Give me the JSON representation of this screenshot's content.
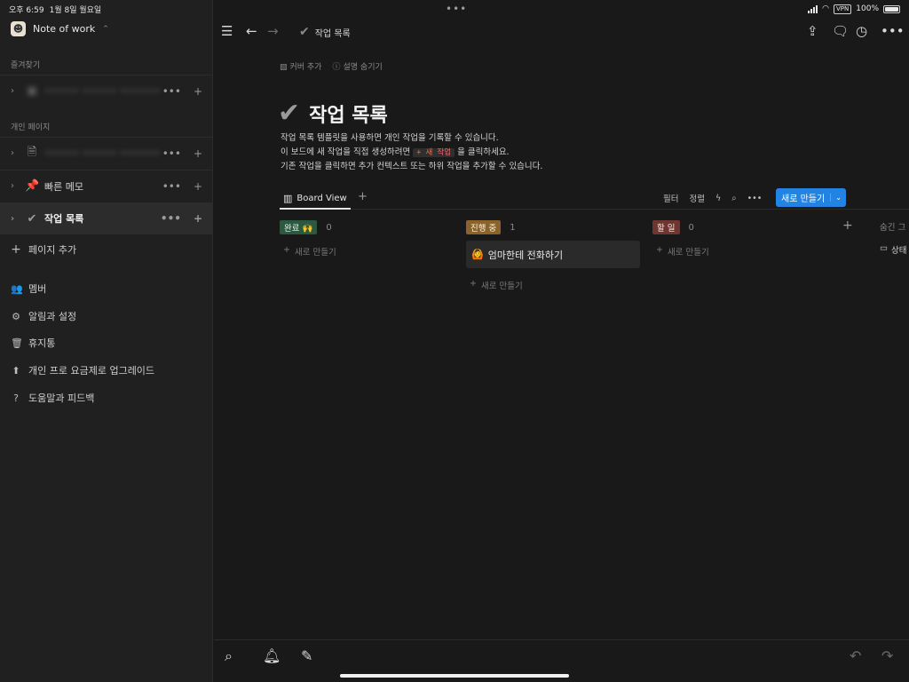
{
  "status": {
    "time": "오후 6:59",
    "date": "1월 8일 월요일",
    "dots": "•••",
    "vpn": "VPN",
    "battery": "100%"
  },
  "sidebar": {
    "workspace": "Note of work",
    "favorites_label": "즐겨찾기",
    "favorites": [
      {
        "label": "•••••• •••••• •••••••"
      }
    ],
    "private_label": "개인 페이지",
    "pages": [
      {
        "label": "•••••• •••••• •••••••",
        "icon": "document-icon",
        "blurred": true
      },
      {
        "label": "빠른 메모",
        "icon": "pushpin-icon"
      },
      {
        "label": "작업 목록",
        "icon": "checkmark-icon",
        "active": true
      }
    ],
    "add_page": "페이지 추가",
    "links": [
      {
        "label": "멤버",
        "icon": "members-icon"
      },
      {
        "label": "알림과 설정",
        "icon": "settings-icon"
      },
      {
        "label": "휴지통",
        "icon": "trash-icon"
      },
      {
        "label": "개인 프로 요금제로 업그레이드",
        "icon": "upgrade-icon"
      },
      {
        "label": "도움말과 피드백",
        "icon": "help-icon"
      }
    ]
  },
  "topbar": {
    "breadcrumb": "작업 목록"
  },
  "page": {
    "add_cover": "커버 추가",
    "hide_description": "설명 숨기기",
    "title": "작업 목록",
    "desc_line1": "작업 목록 템플릿을 사용하면 개인 작업을 기록할 수 있습니다.",
    "desc_line2_pre": "이 보드에 새 작업을 직접 생성하려면",
    "desc_code": "+ 새 작업",
    "desc_line2_post": "을 클릭하세요.",
    "desc_line3": "기존 작업을 클릭하면 추가 컨텍스트 또는 하위 작업을 추가할 수 있습니다."
  },
  "view": {
    "tab": "Board View",
    "filter": "필터",
    "sort": "정렬",
    "new_button": "새로 만들기"
  },
  "board": {
    "columns": [
      {
        "label": "완료 🙌",
        "count": "0",
        "bg": "#2b593f",
        "fg": "#e6f4ea",
        "new": "새로 만들기",
        "cards": []
      },
      {
        "label": "진행 중",
        "count": "1",
        "bg": "#89632a",
        "fg": "#fff2dc",
        "new": "새로 만들기",
        "cards": [
          {
            "emoji": "🙆",
            "title": "엄마한테 전화하기"
          }
        ]
      },
      {
        "label": "할 일",
        "count": "0",
        "bg": "#6e3630",
        "fg": "#fbe4e4",
        "new": "새로 만들기",
        "cards": []
      }
    ],
    "hidden_label": "숨긴 그",
    "hidden_item": "상태"
  },
  "colors": {
    "accent": "#2383e2",
    "background": "#191919",
    "sidebar": "#202020"
  }
}
